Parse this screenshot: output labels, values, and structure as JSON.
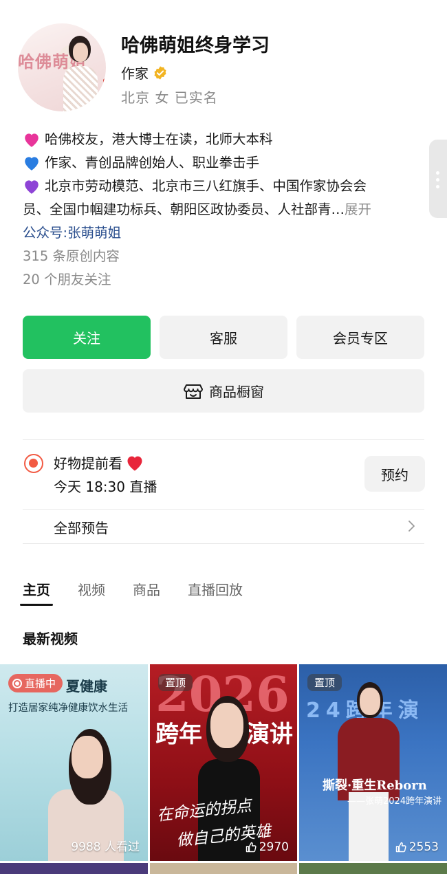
{
  "profile": {
    "avatar_bg_text": "哈佛萌姐",
    "name": "哈佛萌姐终身学习",
    "role": "作家",
    "location_line": "北京  女  已实名"
  },
  "bio": {
    "line1": "哈佛校友，港大博士在读，北师大本科",
    "line2": "作家、青创品牌创始人、职业拳击手",
    "line3": "北京市劳动模范、北京市三八红旗手、中国作家协会会",
    "line4": "员、全国巾帼建功标兵、朝阳区政协委员、人社部青…",
    "expand": "展开",
    "gzh_prefix": "公众号: ",
    "gzh_name": "张萌萌姐",
    "original_count": "315 条原创内容",
    "friends_follow": "20 个朋友关注",
    "heart_colors": [
      "#e8359a",
      "#2a7de1",
      "#8e44d6"
    ]
  },
  "actions": {
    "follow": "关注",
    "service": "客服",
    "member": "会员专区",
    "shop": "商品橱窗"
  },
  "live": {
    "title": "好物提前看",
    "time": "今天 18:30 直播",
    "book": "预约",
    "all_preview": "全部预告"
  },
  "tabs": [
    {
      "label": "主页",
      "active": true
    },
    {
      "label": "视频",
      "active": false
    },
    {
      "label": "商品",
      "active": false
    },
    {
      "label": "直播回放",
      "active": false
    }
  ],
  "section_title": "最新视频",
  "videos": [
    {
      "badge": "直播中",
      "text_title": "夏健康",
      "text_sub": "打造居家纯净健康饮水生活",
      "count": "9988 人看过"
    },
    {
      "badge": "置顶",
      "big_text": "2026",
      "left_text": "跨年",
      "right_text": "演讲",
      "slogan1": "在命运的拐点",
      "slogan2": "做自己的英雄",
      "count": "2970"
    },
    {
      "badge": "置顶",
      "top_text": "24跨年演",
      "title": "撕裂·重生Reborn",
      "sub": "——张萌2024跨年演讲",
      "count": "2553"
    }
  ],
  "colors": {
    "accent_green": "#22c160",
    "live_red": "#f25a43",
    "link_blue": "#2b4f8e",
    "gray_text": "#8a8a8a"
  }
}
